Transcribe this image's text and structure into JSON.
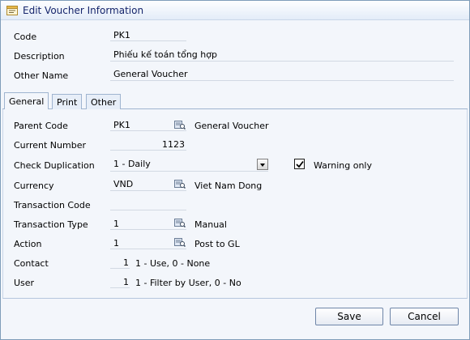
{
  "window": {
    "title": "Edit Voucher Information"
  },
  "header": {
    "code_label": "Code",
    "code_value": "PK1",
    "description_label": "Description",
    "description_value": "Phiếu kế toán tổng hợp",
    "other_name_label": "Other Name",
    "other_name_value": "General Voucher"
  },
  "tabs": [
    {
      "label": "General",
      "active": true
    },
    {
      "label": "Print",
      "active": false
    },
    {
      "label": "Other",
      "active": false
    }
  ],
  "general": {
    "parent_code": {
      "label": "Parent Code",
      "value": "PK1",
      "desc": "General Voucher"
    },
    "current_number": {
      "label": "Current Number",
      "value": "1123"
    },
    "check_duplication": {
      "label": "Check Duplication",
      "value": "1 - Daily"
    },
    "warning_only": {
      "label": "Warning only",
      "checked": true
    },
    "currency": {
      "label": "Currency",
      "value": "VND",
      "desc": "Viet Nam Dong"
    },
    "transaction_code": {
      "label": "Transaction Code",
      "value": ""
    },
    "transaction_type": {
      "label": "Transaction Type",
      "value": "1",
      "desc": "Manual"
    },
    "action": {
      "label": "Action",
      "value": "1",
      "desc": "Post to GL"
    },
    "contact": {
      "label": "Contact",
      "value": "1",
      "desc": "1 - Use, 0 - None"
    },
    "user": {
      "label": "User",
      "value": "1",
      "desc": "1 - Filter by User, 0 - No"
    }
  },
  "footer": {
    "save_label": "Save",
    "cancel_label": "Cancel"
  },
  "icons": {
    "title": "voucher-form-icon",
    "lookup": "lookup-icon",
    "dropdown": "dropdown-arrow-icon",
    "check": "checkmark-icon"
  },
  "colors": {
    "title_text": "#15256b",
    "background": "#f3f6fb",
    "border": "#7f9db9"
  }
}
